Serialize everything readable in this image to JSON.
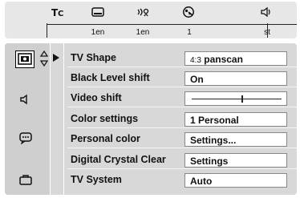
{
  "topbar": {
    "items": [
      {
        "icon": "title-chapter-icon",
        "label": ""
      },
      {
        "icon": "subtitle-icon",
        "label": "1en"
      },
      {
        "icon": "audio-voice-icon",
        "label": "1en"
      },
      {
        "icon": "angle-icon",
        "label": "1"
      },
      {
        "icon": "sound-icon",
        "label": "st"
      }
    ]
  },
  "sidebar": {
    "items": [
      {
        "icon": "picture-icon",
        "selected": true
      },
      {
        "icon": "speaker-icon",
        "selected": false
      },
      {
        "icon": "speech-bubble-icon",
        "selected": false
      },
      {
        "icon": "briefcase-icon",
        "selected": false
      }
    ]
  },
  "menu": {
    "rows": [
      {
        "label": "TV Shape",
        "value_prefix": "4:3",
        "value": "panscan"
      },
      {
        "label": "Black Level shift",
        "value": "On"
      },
      {
        "label": "Video shift",
        "value": ""
      },
      {
        "label": "Color settings",
        "value": "1 Personal"
      },
      {
        "label": "Personal color",
        "value": "Settings..."
      },
      {
        "label": "Digital Crystal Clear",
        "value": "Settings"
      },
      {
        "label": "TV System",
        "value": "Auto"
      }
    ],
    "video_shift_level": 0.55
  }
}
